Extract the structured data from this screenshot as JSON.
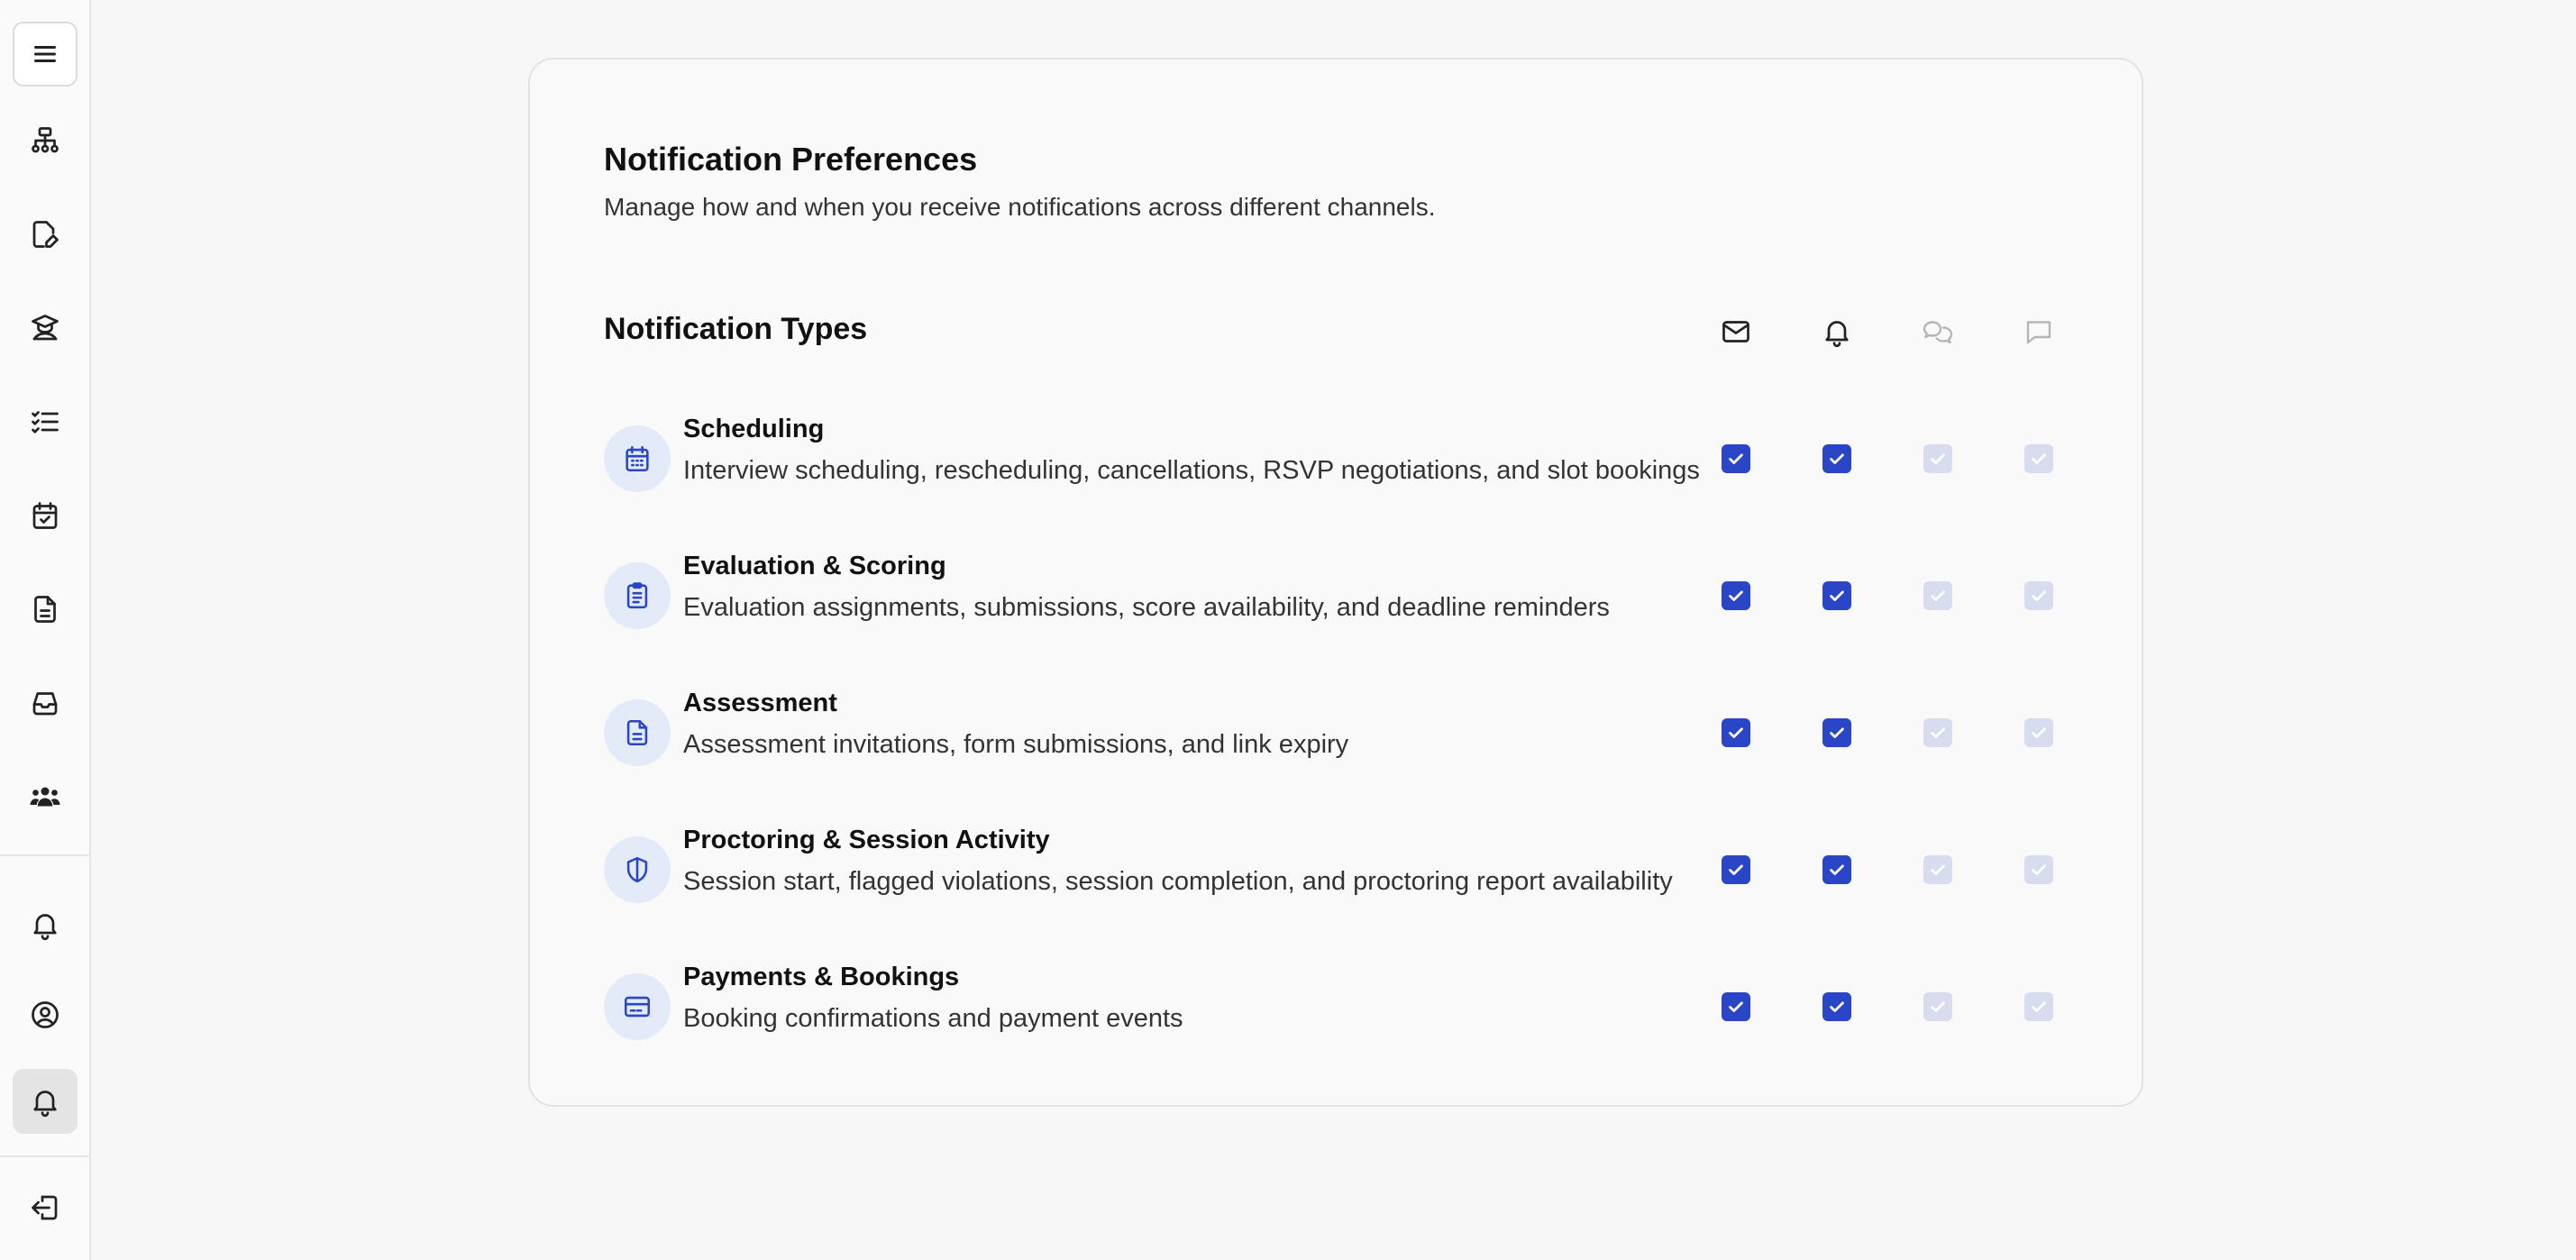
{
  "sidebar": {
    "items": [
      {
        "icon": "menu-icon"
      },
      {
        "icon": "org-chart-icon"
      },
      {
        "icon": "file-edit-icon"
      },
      {
        "icon": "graduate-icon"
      },
      {
        "icon": "checklist-icon"
      },
      {
        "icon": "calendar-check-icon"
      },
      {
        "icon": "document-icon"
      },
      {
        "icon": "inbox-icon"
      },
      {
        "icon": "users-icon"
      },
      {
        "icon": "bell-icon"
      },
      {
        "icon": "user-circle-icon"
      },
      {
        "icon": "bell-icon",
        "active": true
      },
      {
        "icon": "logout-icon"
      }
    ]
  },
  "page": {
    "title": "Notification Preferences",
    "subtitle": "Manage how and when you receive notifications across different channels.",
    "types_heading": "Notification Types"
  },
  "channels": [
    {
      "icon": "mail-icon",
      "enabled": true
    },
    {
      "icon": "bell-icon",
      "enabled": true
    },
    {
      "icon": "chat-bubbles-icon",
      "enabled": false
    },
    {
      "icon": "message-icon",
      "enabled": false
    }
  ],
  "notification_types": [
    {
      "icon": "calendar-grid-icon",
      "title": "Scheduling",
      "description": "Interview scheduling, rescheduling, cancellations, RSVP negotiations, and slot bookings",
      "checked": [
        true,
        true,
        true,
        true
      ]
    },
    {
      "icon": "clipboard-icon",
      "title": "Evaluation & Scoring",
      "description": "Evaluation assignments, submissions, score availability, and deadline reminders",
      "checked": [
        true,
        true,
        true,
        true
      ]
    },
    {
      "icon": "file-text-icon",
      "title": "Assessment",
      "description": "Assessment invitations, form submissions, and link expiry",
      "checked": [
        true,
        true,
        true,
        true
      ]
    },
    {
      "icon": "shield-icon",
      "title": "Proctoring & Session Activity",
      "description": "Session start, flagged violations, session completion, and proctoring report availability",
      "checked": [
        true,
        true,
        true,
        true
      ]
    },
    {
      "icon": "credit-card-icon",
      "title": "Payments & Bookings",
      "description": "Booking confirmations and payment events",
      "checked": [
        true,
        true,
        true,
        true
      ]
    }
  ],
  "colors": {
    "accent": "#2a46c7",
    "disabled_checkbox": "#d7dcef",
    "icon_circle": "#e3eaf8"
  }
}
